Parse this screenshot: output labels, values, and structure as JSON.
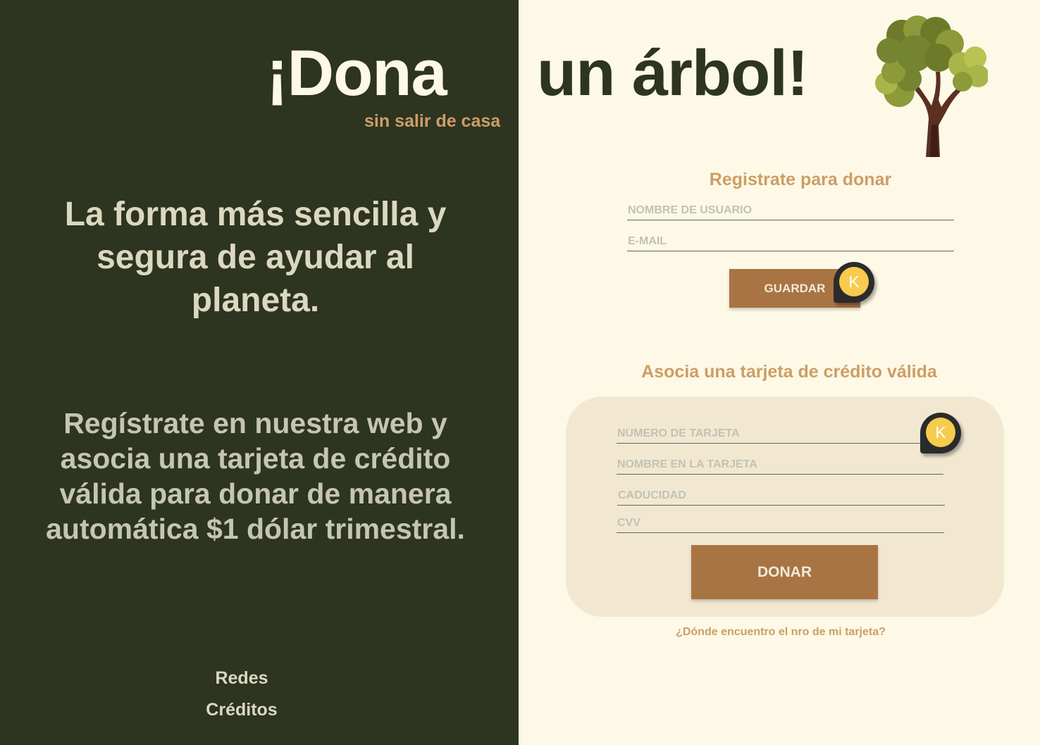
{
  "header": {
    "title_left": "¡Dona",
    "title_right": "un árbol!",
    "subtitle": "sin salir de casa"
  },
  "left": {
    "lead": "La forma más sencilla y segura de ayudar al planeta.",
    "info": "Regístrate en nuestra web y asocia una tarjeta de crédito válida para donar de manera automática $1 dólar trimestral.",
    "links": [
      "Redes",
      "Créditos"
    ]
  },
  "register": {
    "title": "Registrate para donar",
    "username_placeholder": "NOMBRE DE USUARIO",
    "email_placeholder": "E-MAIL",
    "save_label": "GUARDAR"
  },
  "card": {
    "title": "Asocia una tarjeta de crédito válida",
    "number_placeholder": "NÚMERO DE TARJETA",
    "name_placeholder": "NOMBRE EN LA TARJETA",
    "expiry_placeholder": "CADUCIDAD",
    "cvv_placeholder": "CVV",
    "donate_label": "DONAR",
    "help_link": "¿Dónde encuentro el nro de mi tarjeta?"
  },
  "markers": {
    "letter": "K"
  },
  "colors": {
    "dark_green": "#2d3420",
    "cream": "#fdf9e6",
    "accent": "#cc9e66",
    "button": "#a97444",
    "card_bg": "#f2e8d2",
    "marker_yellow": "#f7cb4d"
  },
  "icons": {
    "tree": "tree-icon"
  }
}
